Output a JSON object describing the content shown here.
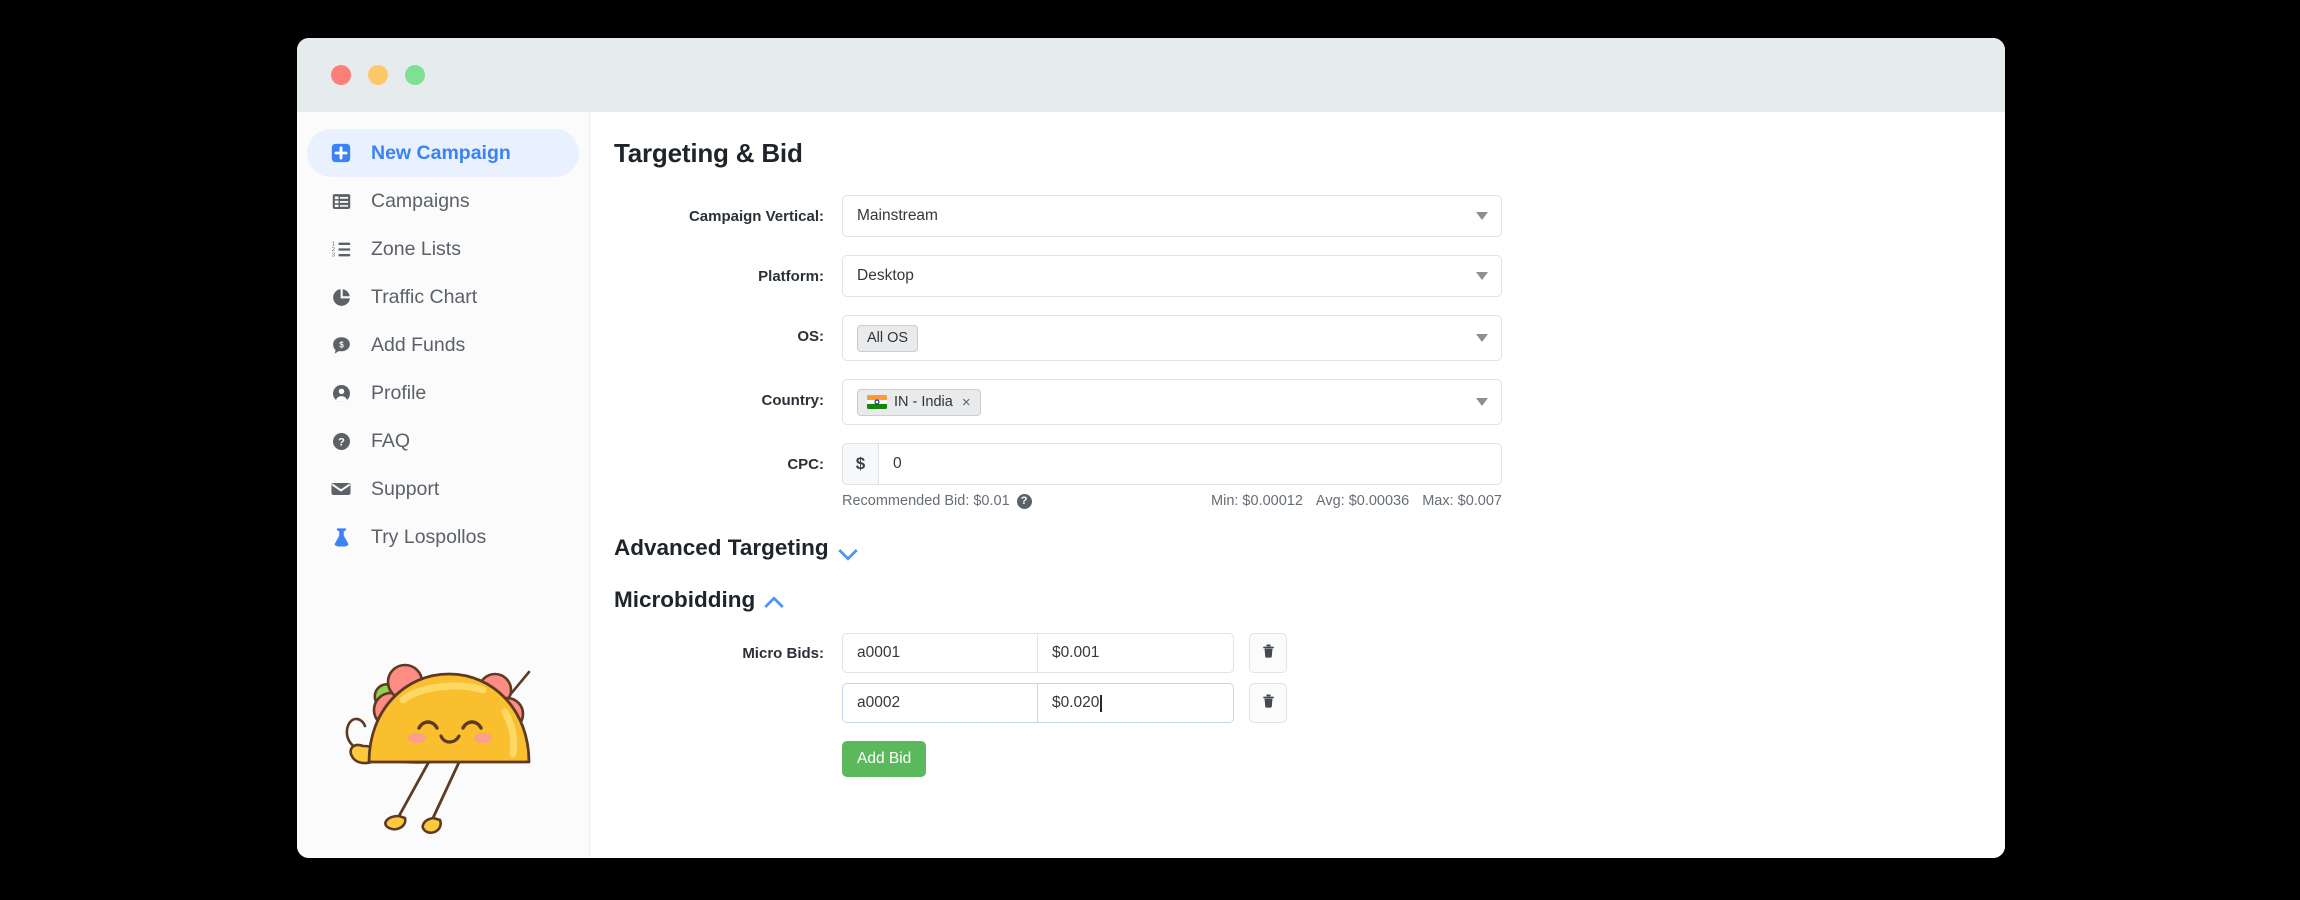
{
  "window": {
    "traffic_lights": [
      "close",
      "minimize",
      "maximize"
    ]
  },
  "sidebar": {
    "items": [
      {
        "label": "New Campaign",
        "icon": "plus-square-icon",
        "active": true
      },
      {
        "label": "Campaigns",
        "icon": "list-table-icon",
        "active": false
      },
      {
        "label": "Zone Lists",
        "icon": "ordered-list-icon",
        "active": false
      },
      {
        "label": "Traffic Chart",
        "icon": "pie-chart-icon",
        "active": false
      },
      {
        "label": "Add Funds",
        "icon": "money-bubble-icon",
        "active": false
      },
      {
        "label": "Profile",
        "icon": "user-circle-icon",
        "active": false
      },
      {
        "label": "FAQ",
        "icon": "question-circle-icon",
        "active": false
      },
      {
        "label": "Support",
        "icon": "envelope-icon",
        "active": false
      },
      {
        "label": "Try Lospollos",
        "icon": "flask-icon",
        "active": false
      }
    ],
    "mascot": "taco-mascot-illustration"
  },
  "main": {
    "page_title": "Targeting & Bid",
    "fields": {
      "campaign_vertical": {
        "label": "Campaign Vertical:",
        "value": "Mainstream"
      },
      "platform": {
        "label": "Platform:",
        "value": "Desktop"
      },
      "os": {
        "label": "OS:",
        "chip": "All OS"
      },
      "country": {
        "label": "Country:",
        "chip": "IN - India",
        "chip_remove": "×",
        "flag": "india-flag-icon"
      },
      "cpc": {
        "label": "CPC:",
        "prefix": "$",
        "value": "0"
      }
    },
    "bid_meta": {
      "recommended": "Recommended Bid: $0.01",
      "help": "?",
      "min": "Min: $0.00012",
      "avg": "Avg: $0.00036",
      "max": "Max: $0.007"
    },
    "sections": {
      "advanced_targeting": {
        "label": "Advanced Targeting",
        "expanded": false
      },
      "microbidding": {
        "label": "Microbidding",
        "expanded": true
      }
    },
    "microbidding": {
      "label": "Micro Bids:",
      "rows": [
        {
          "zone": "a0001",
          "price": "$0.001",
          "focused": false,
          "delete_icon": "trash-icon"
        },
        {
          "zone": "a0002",
          "price": "$0.020",
          "focused": true,
          "delete_icon": "trash-icon"
        }
      ],
      "add_button": "Add Bid"
    }
  },
  "colors": {
    "accent": "#3b82f6",
    "success": "#5cb85c",
    "titlebar": "#e6ecee"
  }
}
